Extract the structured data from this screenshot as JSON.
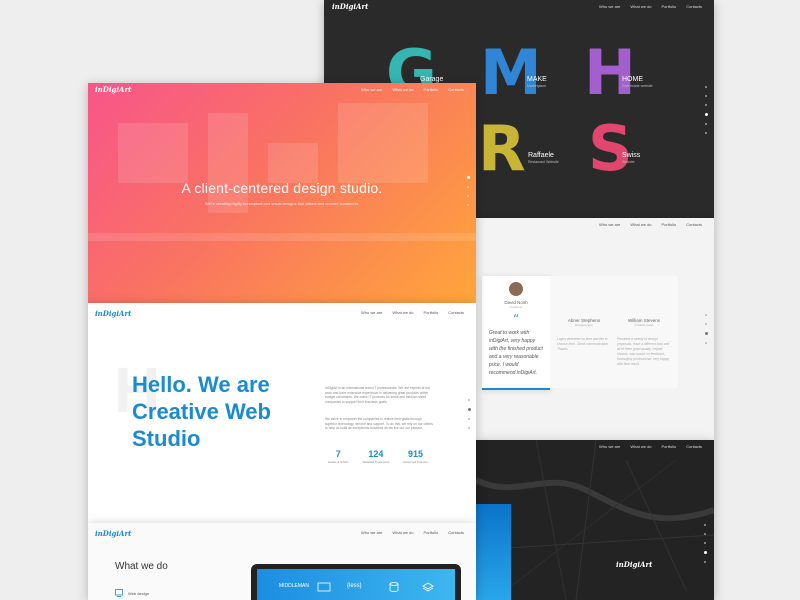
{
  "brand": {
    "logo": "inDigiArt",
    "accent": "#1b8bd0"
  },
  "nav": {
    "items": [
      "Who we are",
      "What we do",
      "Portfolio",
      "Contacts"
    ]
  },
  "portfolio": {
    "projects": [
      {
        "letter": "G",
        "name": "Garage",
        "subtitle": "",
        "color": "#35b6b0"
      },
      {
        "letter": "M",
        "name": "MAKE",
        "subtitle": "Marketplace",
        "color": "#2f86d6"
      },
      {
        "letter": "H",
        "name": "HOME",
        "subtitle": "Real estate website",
        "color": "#a45fcf"
      },
      {
        "letter": "R",
        "name": "Raffaele",
        "subtitle": "Restaurant Website",
        "color": "#c9b535"
      },
      {
        "letter": "S",
        "name": "Swiss",
        "subtitle": "Website",
        "color": "#e0466e"
      }
    ]
  },
  "testimonials": {
    "people": [
      {
        "name": "David Nosh",
        "role": "Customer",
        "quote": "Great to work with inDigiArt, very happy with the finished product and a very reasonable price. I would recommend inDigiArt."
      },
      {
        "name": "Abner Stephens",
        "role": "Entrepreneur",
        "quote": "Logos delivered on time and fair to choose from. Good communication. Thanks"
      },
      {
        "name": "William Stevens",
        "role": "Creative Lead",
        "quote": "Provided a variety of design proposals, each a different look and all of them good quality, helped choose, was based on feedback, thoroughly professional, very happy with final result."
      }
    ]
  },
  "hero": {
    "title": "A client-centered design studio.",
    "subtitle": "We're creating highly conceptual and visual designs that attract and convert customers."
  },
  "hello": {
    "title": "Hello. We are Creative Web Studio",
    "ghost": "H",
    "paragraph1": "inDigiArt is an international team IT professionals. We are experts at our work and have extensive experience in delivering great products within budget constraints. We make IT products for small and medium sized companies to support their business goals.",
    "paragraph2": "We strive to empower the companies to realize their goals through superior technology, service and support. To do this, we rely on our clients to help us build an exceptional business as we live out our passion.",
    "stats": [
      {
        "value": "7",
        "label": "Geeks & Artists"
      },
      {
        "value": "124",
        "label": "Satisfied Customers"
      },
      {
        "value": "915",
        "label": "Delivered Projects"
      }
    ]
  },
  "what": {
    "title": "What we do",
    "service": "Web design",
    "technologies": [
      "MIDDLEMAN",
      "{less}"
    ]
  }
}
